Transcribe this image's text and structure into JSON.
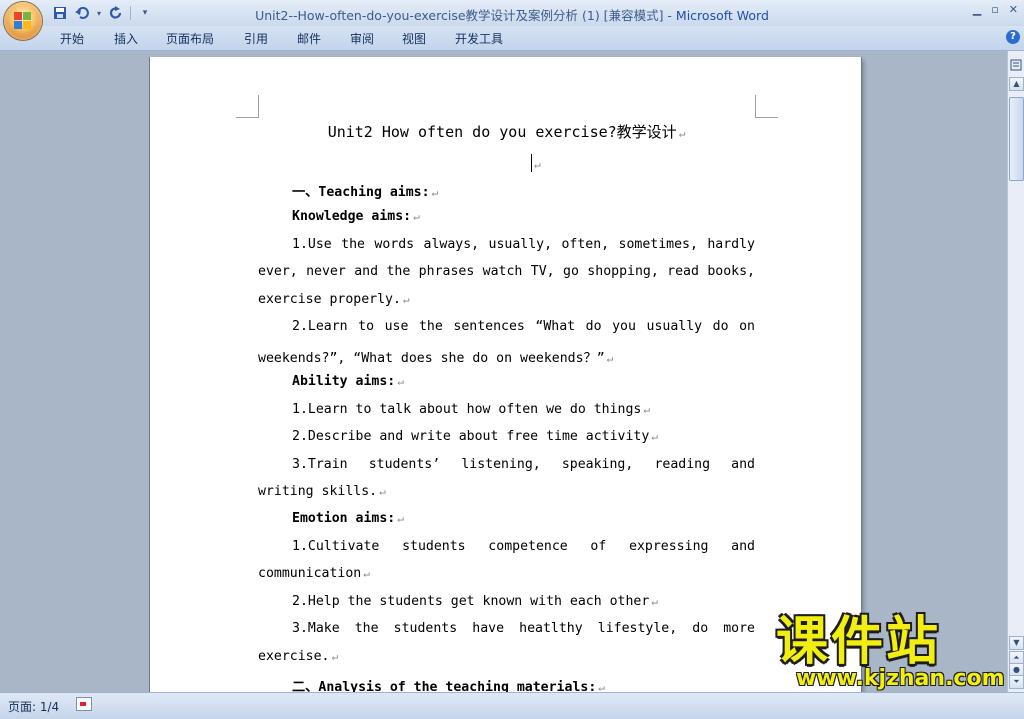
{
  "window": {
    "doc_title": "Unit2--How-often-do-you-exercise教学设计及案例分析 (1) [兼容模式]",
    "separator": " - ",
    "app_name": "Microsoft Word",
    "controls": [
      "▁",
      "▫",
      "✕"
    ]
  },
  "qat": {
    "save_icon": "save-icon",
    "undo_icon": "undo-icon",
    "redo_icon": "repeat-icon",
    "customize": "▾"
  },
  "ribbon_tabs": [
    "开始",
    "插入",
    "页面布局",
    "引用",
    "邮件",
    "审阅",
    "视图",
    "开发工具"
  ],
  "help": "?",
  "document": {
    "title": "Unit2  How often do you exercise?教学设计",
    "sections": [
      {
        "text": "一、Teaching aims:",
        "bold": true
      },
      {
        "text": "Knowledge aims:",
        "bold": true
      },
      {
        "text": "1.Use the words always, usually, often, sometimes, hardly"
      },
      {
        "text": "ever, never and the phrases watch TV, go shopping, read books,"
      },
      {
        "text": "exercise properly."
      },
      {
        "text": "2.Learn to use the sentences “What do you usually do on"
      },
      {
        "text": "weekends?”, “What does she do on weekends？”"
      },
      {
        "text": "Ability aims:",
        "bold": true
      },
      {
        "text": "1.Learn to talk about how often we do things"
      },
      {
        "text": "2.Describe and write about free time activity"
      },
      {
        "text": "3.Train students’ listening, speaking, reading and"
      },
      {
        "text": "writing skills."
      },
      {
        "text": "Emotion aims:",
        "bold": true
      },
      {
        "text": "1.Cultivate students competence of expressing and"
      },
      {
        "text": "communication"
      },
      {
        "text": "2.Help the students get known with each other"
      },
      {
        "text": "3.Make the students have heatlthy lifestyle, do more"
      },
      {
        "text": "exercise."
      },
      {
        "text": "二、Analysis of the teaching materials:",
        "bold": true
      }
    ],
    "paragraph_mark": "↵"
  },
  "status": {
    "page": "页面: 1/4"
  },
  "watermark": {
    "big": "课件站",
    "url": "www.kjzhan.com"
  },
  "colors": {
    "accent": "#1f4ea8",
    "ribbon": "#c3d4ec",
    "workspace": "#a9b6c8",
    "watermark": "#f1ee10"
  }
}
